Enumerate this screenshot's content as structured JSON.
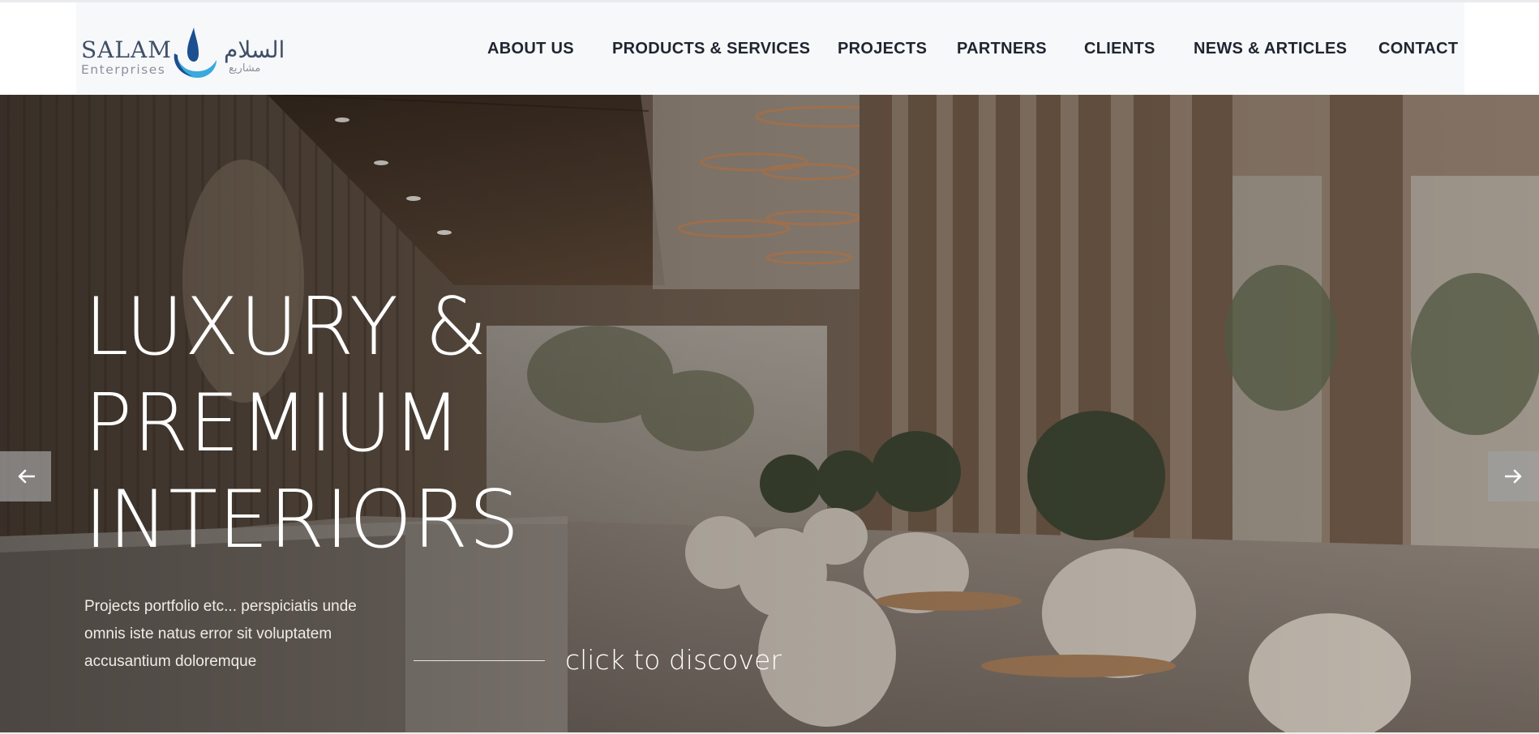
{
  "brand": {
    "name": "SALAM",
    "tagline": "Enterprises",
    "arabic_name": "السلام",
    "arabic_tagline": "مشاريع",
    "logo_colors": [
      "#1b4f8f",
      "#3aa9e0"
    ]
  },
  "nav": {
    "items": [
      {
        "label": "ABOUT US"
      },
      {
        "label": "PRODUCTS & SERVICES"
      },
      {
        "label": "PROJECTS"
      },
      {
        "label": "PARTNERS"
      },
      {
        "label": "CLIENTS"
      },
      {
        "label": "NEWS & ARTICLES"
      },
      {
        "label": "CONTACT"
      }
    ]
  },
  "hero": {
    "title_lines": [
      "LUXURY &",
      "PREMIUM",
      "INTERIORS"
    ],
    "description": "Projects portfolio etc... perspiciatis unde omnis iste natus error sit voluptatem accusantium doloremque",
    "cta": "click to discover",
    "prev_icon": "arrow-left-icon",
    "next_icon": "arrow-right-icon"
  },
  "colors": {
    "nav_text": "#1f2530",
    "header_bg": "#f7f8fa",
    "hero_text": "#ffffff"
  }
}
